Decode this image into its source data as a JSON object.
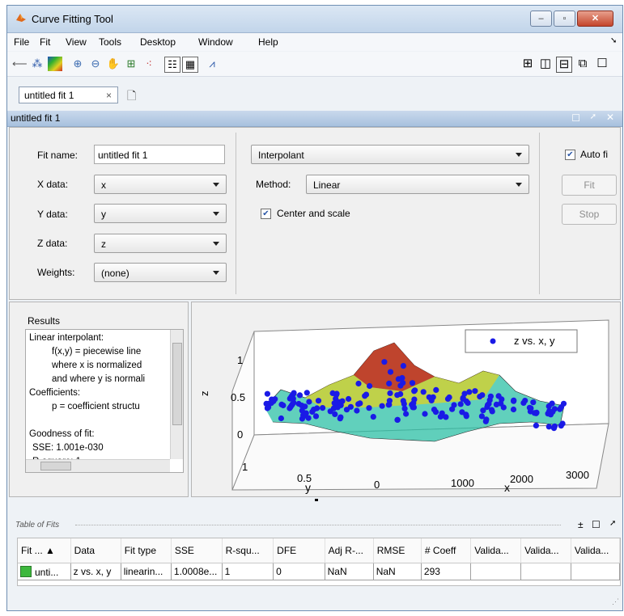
{
  "window": {
    "title": "Curve Fitting Tool",
    "controls": [
      "–",
      "▫",
      "✕"
    ]
  },
  "menu": [
    "File",
    "Fit",
    "View",
    "Tools",
    "Desktop",
    "Window",
    "Help"
  ],
  "toolbar_icons": [
    "back-arrow-icon",
    "data-icon",
    "colormap-icon",
    "zoom-in-icon",
    "zoom-out-icon",
    "pan-icon",
    "data-cursor-icon",
    "exclude-icon",
    "legend-icon",
    "grid-icon",
    "residuals-icon",
    "tile-icon",
    "split-vertical-icon",
    "split-horizontal-icon",
    "undock-icon",
    "maximize-icon"
  ],
  "tab": {
    "label": "untitled fit 1",
    "close": "×"
  },
  "panel_title": "untitled fit 1",
  "fit": {
    "fit_name_label": "Fit name:",
    "fit_name_value": "untitled fit 1",
    "x_label": "X data:",
    "x_value": "x",
    "y_label": "Y data:",
    "y_value": "y",
    "z_label": "Z data:",
    "z_value": "z",
    "weights_label": "Weights:",
    "weights_value": "(none)",
    "fit_type": "Interpolant",
    "method_label": "Method:",
    "method_value": "Linear",
    "center_scale_label": "Center and scale",
    "auto_fit_label": "Auto fi",
    "fit_button": "Fit",
    "stop_button": "Stop"
  },
  "results": {
    "title": "Results",
    "lines": [
      "Linear interpolant:",
      "f(x,y) = piecewise line",
      "where x is normalized",
      "and where y is normali",
      "Coefficients:",
      "p = coefficient structu",
      "",
      "Goodness of fit:",
      "SSE: 1.001e-030",
      "R-square: 1"
    ]
  },
  "plot": {
    "legend": "z vs. x, y",
    "zlabel": "z",
    "xlabel": "x",
    "ylabel": "y",
    "z_ticks": [
      "1",
      "0.5",
      "0"
    ],
    "x_ticks": [
      "0",
      "1000",
      "2000",
      "3000"
    ],
    "y_ticks": [
      "1",
      "0.5"
    ]
  },
  "table_of_fits": {
    "title": "Table of Fits",
    "columns": [
      "Fit ... ▲",
      "Data",
      "Fit type",
      "SSE",
      "R-squ...",
      "DFE",
      "Adj R-...",
      "RMSE",
      "# Coeff",
      "Valida...",
      "Valida...",
      "Valida..."
    ],
    "rows": [
      [
        "unti...",
        "z vs. x, y",
        "linearin...",
        "1.0008e...",
        "1",
        "0",
        "NaN",
        "NaN",
        "293",
        "",
        "",
        ""
      ]
    ]
  }
}
